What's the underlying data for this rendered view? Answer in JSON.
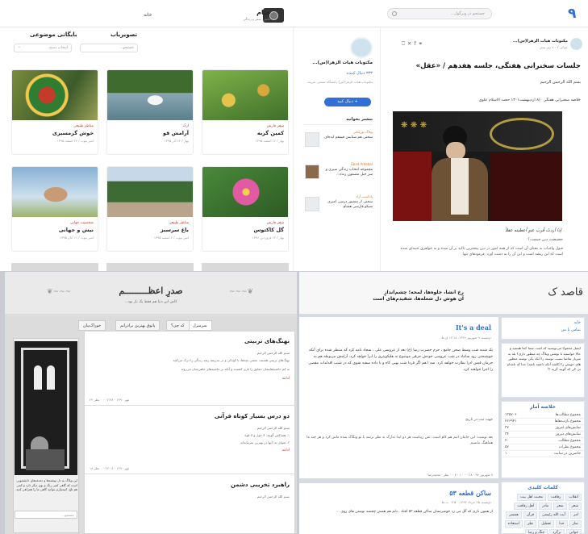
{
  "topbar": {
    "search_placeholder": "جستجو در ویرگول...",
    "brand_title": "جنام",
    "brand_sub": "عکس، سفر و زندگی",
    "home_link": "خانه"
  },
  "listing": {
    "tabs": [
      "تصویریاب",
      "بایگانی موضوعی"
    ],
    "filter1": "جستجو...",
    "filter2": "انتخاب دسته",
    "cards": [
      {
        "cat": "مناظر طبیعی",
        "title": "خوش گرمسیری",
        "meta": "امیر بیوت / ۲۲ اسفند ۱۳۹۵"
      },
      {
        "cat": "ارک",
        "title": "آرامش قو",
        "meta": "بهار / ۱۲ آذر ۱۳۹۵"
      },
      {
        "cat": "سفر فارس",
        "title": "کمین گربه",
        "meta": "بهار / ۱۲ اسفند ۱۳۹۵"
      },
      {
        "cat": "شخصیت جهانی",
        "title": "نیش و جهانی",
        "meta": "امیر بیوت / ۱۱ آبان ۱۳۹۵"
      },
      {
        "cat": "مناظر طبیعی",
        "title": "باغ سرسبز",
        "meta": "امیر بیوت / ۲ اسفند ۱۳۹۵"
      },
      {
        "cat": "سفر فارس",
        "title": "گل کاکتوس",
        "meta": "بهار / ۱۲ فروردین ۱۳۹۶"
      }
    ]
  },
  "profile": {
    "name": "مکتوبات هیات الزهرا(س)...",
    "count": "۳۳۳ دنبال کننده",
    "desc": "مکتوبات هیات الزهرا(س) دانشگاه صنعتی شریف",
    "follow": "دنبال کنید +",
    "recent_title": "بیشتر بخوانید",
    "recent": [
      {
        "who": "وبلاگ پورمتانی",
        "txt": "سخنی هم ستایش قشقم ایده‌ای"
      },
      {
        "who": "Ebad Ardebal",
        "txt": "مجموعه انتخاب زندگی سیری و سر خیل مضمون زنده..."
      },
      {
        "who": "پادکست آزاد",
        "txt": "سخنی از منصور درسی امیری شیکو فارسی هشام"
      }
    ]
  },
  "article": {
    "author": "مکتوبات هیات الزهرا(س)...",
    "date": "جوانی ۷ · ۷ روز پیش",
    "title": "جلسات سخنرانی هفتگی، جلسه هفدهم / «عقل»",
    "p1": "بسم الله الرحمن الرحیم",
    "p2": "خلاصه سخنرانی هفتگی ۸/۰ اردیبهشت۱۴۰۱ حجت الاسلام علوی",
    "caption": "إذا أردتُ قُربَ عبدٍ أعطيته عقلاً",
    "p3": "حضیضت دین چیست؟",
    "p4": "قبول واجبات به معنای آن است که از همه امور در دین بیشترین تاکید بر آن شده و به جواهری جنبه‌ای شده است که این ریشه است و این آن را به دست آورد. فرمودهای تنها"
  },
  "blog3": {
    "title": "صدرِ اعظـــــــــم",
    "sub": "کاش این دنیا هم فقط یک بار بود...",
    "nav": [
      "سرمنزل",
      "که چی؟",
      "پاتوق بهترین برادرانم",
      "خوراک‌بیان"
    ],
    "posts": [
      {
        "title": "نهنگ‌های تربیتی",
        "l1": "بسم الله الرحمن الرحیم",
        "l2": "نهنگ‌های تربیتی هستند، بعضی بچه‌ها، با کودکی و در مدرسه رشد زندگی را درک می‌کنند",
        "l3": "نه کم حاشیه‌هایشان حقایق را بازی کشیده و آنکه بر حاشیه‌های ماهی‌شان می‌روند",
        "red": "ادامه",
        "foot": "۲۴ مهر ۱۳۹۰ - ۰۷:۳۸ · ۰ نظر"
      },
      {
        "title": "دو درس بسیار کوتاه قرآنی",
        "l1": "بسم الله الرحمن الرحیم",
        "l2": "۱. همه‌کس گویند: لا حول و لا قوة",
        "l3": "۲. تقوای نه: آنها در بهترین سرمایه‌اند",
        "red": "ادامه",
        "foot": "۱۸ مهر ۱۳۹۰ - ۲۲:۰۸ · ۰ نظر"
      },
      {
        "title": "راهبرد تخریبی دشمن",
        "l1": "بسم الله الرحمن الرحیم",
        "l2": "",
        "l3": "",
        "red": "",
        "foot": ""
      }
    ],
    "side_text": "این وبلاگ به دل نوشته‌ها و دغدغه‌های دانشجویی است که گاهی کمی رنگ و بوی دیگر دارد و کمی هم تلخ. امیدوارم بتوانید گاهی ما را همراهی کنید.",
    "side_search": "جستجو..."
  },
  "blog4": {
    "logo": "قاصد ک",
    "slogan": "رخ انشا، جلوه‌ها، لمحه؛ چشم‌اندازِ\nآن هوش دل شعله‌ها، شقیدم‌های است",
    "post_title": "It's a deal",
    "post_date": "دوشنبه، ۹ شهریور ۱۳۹۴، ۱۲:۱۸ ق.ظ",
    "body1": "یک شنبه شب وسط صحن جامع ، حرم حضرت رضا (ع) بعد از عروسی علی ، سجاد نامه کرد که منتظر شده برای آنکه خوشبختی زود ساماد در شب عروسی خودش حرفی موضوع به هلیکوپتری را ابرا خواهد کرد، آرامش مربوطه هم به حرمان فیس ادرا نظارت خواهد کرد. سه ا هم اگر فردا شب نهیی کاه و با داده سفید شوی که در شیب اقدامات مقصی را اجرا خواهند کرد.",
    "body2": "جهت ثبت در تاریخ",
    "body3": "بعد نوشت: این جایتان انیم هم کام است: تس زیبا‌ست هر دو ابدا تدارک به نظر برسد با تو ونگاک شده ماش کرد و هر چند ما هماهنگ نباشیم",
    "foot": "۹ شهریور ۹۴ · ۰۰:۱۸ · ۱ · ۴ · ۰ نظر · محمدرضا",
    "post2_title": "ساکن قطعه ۵۳",
    "post2_date": "دوشنبه، ۲۵ خرداد ۱۳۹۴، ۰۷:۵۰ ب.ظ",
    "post2_body": "از همون بازی که گل می زد خوشرنشان ساکن قطعه ۵۳ افتاد ، دلم هم همش چجشه نوشتن های روی ..."
  },
  "widgets": {
    "menu": [
      "خانه",
      "تماس با من"
    ],
    "about": "ایمیل محمولا می‌نویسید که اشت شما کجا هستید و حالا خواستید تا نوشتن وبلاگ چه منظور داری؟ بله به سرباز تقاضا نسیت توسته را آنکه یکی نوشته منظور های خوبش را (کاشه آنکه داشته باشد) خدا که نامه‌ام تی کی که گویند گریه ؟!",
    "stats_title": "خلاصه آمار",
    "stats": [
      [
        "مجموع مطالب‌ها",
        "۱۳۵۷۰۶"
      ],
      [
        "مجموع بازدید‌ها‌ها",
        "۲۶۶۹۴۱"
      ],
      [
        "نمایش‌های امروز",
        "۳۷"
      ],
      [
        "نمایش‌های دیروز",
        "۳۴"
      ],
      [
        "مجموع مطالب",
        "۲۰"
      ],
      [
        "مجموع نظرات",
        "۵۷"
      ],
      [
        "حاضرین در سایت",
        "۱"
      ]
    ],
    "tags_title": "کلمات کلیدی",
    "tags": [
      "انقلاب",
      "رفاقت",
      "محبت اهل بیت",
      "شعر",
      "شعر",
      "مادر",
      "اهل رفاقت",
      "امر",
      "آیت الله رئیسی",
      "قرآن",
      "همسر",
      "نماز",
      "خدا",
      "تعطیل",
      "نظر",
      "استعاذه",
      "جوانی",
      "برگرد",
      "جنگ و رضا"
    ]
  }
}
